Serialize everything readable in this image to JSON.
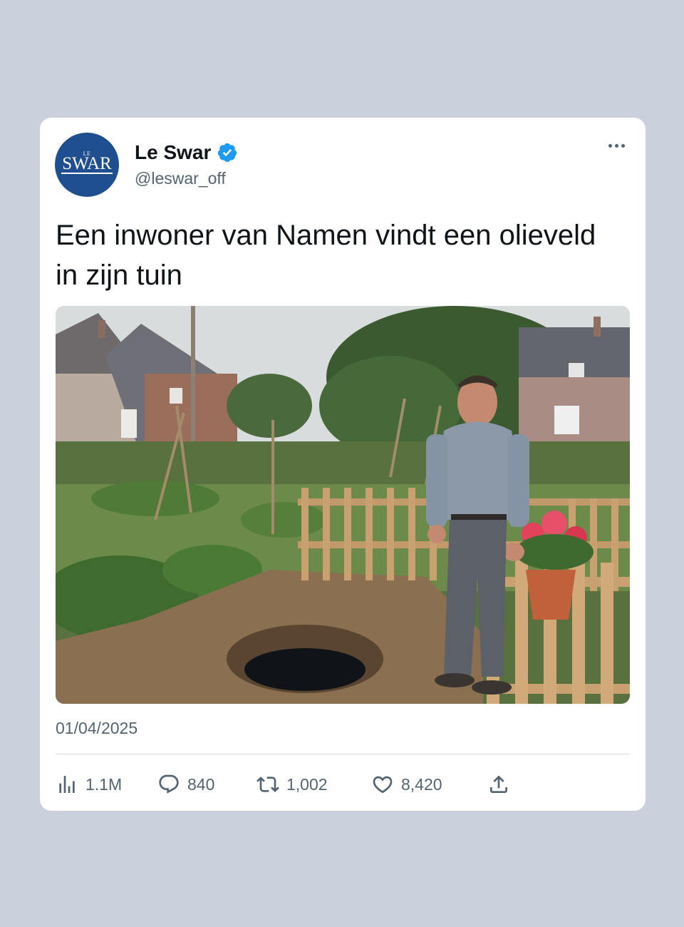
{
  "tweet": {
    "author": {
      "display_name": "Le Swar",
      "handle": "@leswar_off",
      "verified": true,
      "avatar_text_small": "LE",
      "avatar_text": "SWAR",
      "avatar_color": "#1f4f8f"
    },
    "text": "Een inwoner van Namen vindt een olieveld in zijn tuin",
    "date": "01/04/2025",
    "stats": {
      "views": "1.1M",
      "replies": "840",
      "reposts": "1,002",
      "likes": "8,420"
    },
    "icons": {
      "views": "views-chart-icon",
      "replies": "reply-bubble-icon",
      "reposts": "repost-icon",
      "likes": "heart-icon",
      "share": "share-upload-icon",
      "more": "more-dots-icon",
      "verified": "verified-badge-icon"
    },
    "colors": {
      "accent": "#1d9bf0",
      "muted_text": "#536471",
      "background": "#cad1dc"
    }
  }
}
